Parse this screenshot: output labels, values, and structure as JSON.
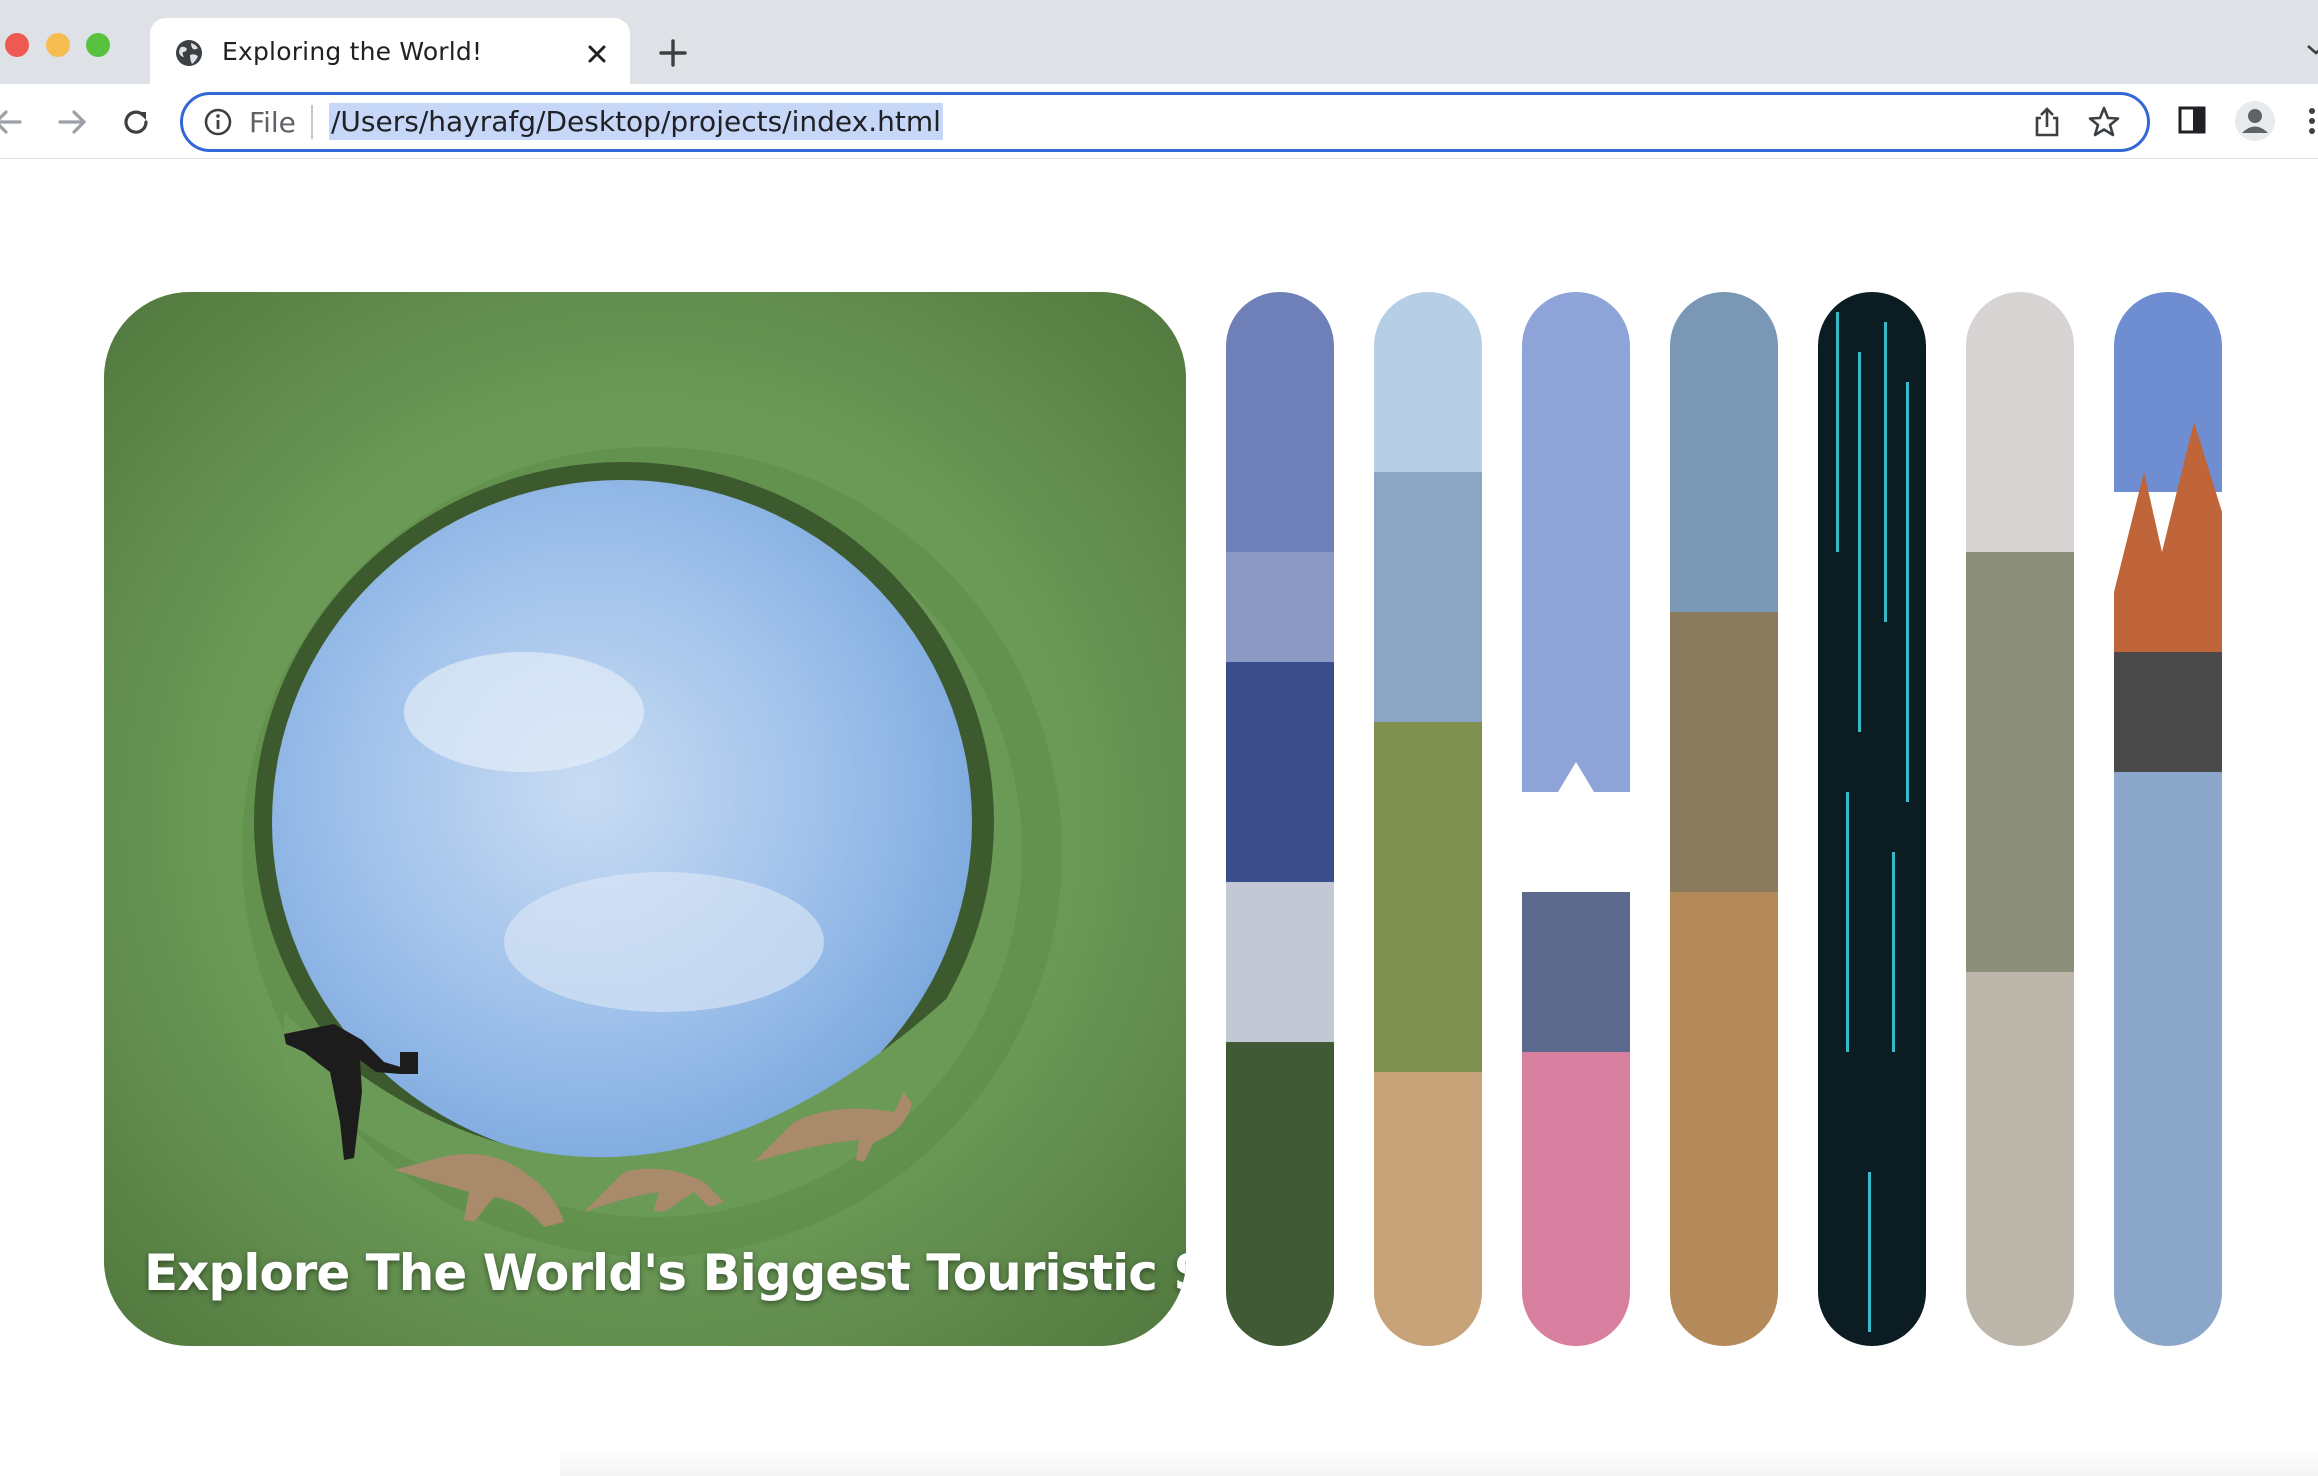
{
  "browser": {
    "tab": {
      "title": "Exploring the World!"
    },
    "address_bar": {
      "scheme_label": "File",
      "url": "/Users/hayrafg/Desktop/projects/index.html"
    },
    "icons": {
      "tab_favicon": "globe-icon",
      "tab_close": "close-icon",
      "new_tab": "plus-icon",
      "back": "arrow-left-icon",
      "forward": "arrow-right-icon",
      "reload": "reload-icon",
      "site_info": "info-icon",
      "share": "share-icon",
      "bookmark": "star-icon",
      "side_panel": "side-panel-icon",
      "profile": "profile-icon",
      "menu": "kebab-menu-icon"
    }
  },
  "page": {
    "hero": {
      "caption": "Explore The World's Biggest Touristic Spots!",
      "image": "tiny-planet-grass-sky-kangaroos"
    },
    "panels": [
      {
        "image": "coastal-city-bay-mountains"
      },
      {
        "image": "desert-cactus-mountain-path"
      },
      {
        "image": "mount-fuji-cherry-blossoms"
      },
      {
        "image": "hillside-village-street"
      },
      {
        "image": "glowworm-cave"
      },
      {
        "image": "mountain-boardwalk-stairs"
      },
      {
        "image": "patagonia-peaks-lake"
      }
    ]
  },
  "colors": {
    "address_focus": "#3367d6",
    "url_selection": "#c7d7f8",
    "tabbar_bg": "#dee1e6"
  }
}
